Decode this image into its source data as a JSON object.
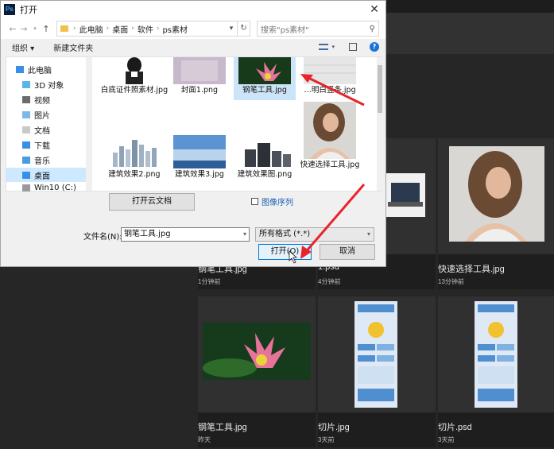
{
  "dialog": {
    "title": "打开",
    "app_logo": "Ps",
    "close_glyph": "✕",
    "breadcrumb": [
      "此电脑",
      "桌面",
      "软件",
      "ps素材"
    ],
    "search_placeholder": "搜索\"ps素材\"",
    "toolbar": {
      "organize": "组织 ▾",
      "new_folder": "新建文件夹"
    },
    "sidebar": [
      {
        "label": "此电脑",
        "icon": "computer-icon"
      },
      {
        "label": "3D 对象",
        "icon": "3d-objects-icon"
      },
      {
        "label": "视频",
        "icon": "video-icon"
      },
      {
        "label": "图片",
        "icon": "pictures-icon"
      },
      {
        "label": "文档",
        "icon": "documents-icon"
      },
      {
        "label": "下载",
        "icon": "downloads-icon"
      },
      {
        "label": "音乐",
        "icon": "music-icon"
      },
      {
        "label": "桌面",
        "icon": "desktop-icon",
        "selected": true
      },
      {
        "label": "Win10 (C:)",
        "icon": "drive-icon"
      }
    ],
    "files": [
      {
        "name": "白底证件照素材.jpg"
      },
      {
        "name": "封面1.png"
      },
      {
        "name": "钢笔工具.jpg",
        "selected": true
      },
      {
        "name": "…明白竖条.jpg"
      },
      {
        "name": "建筑效果2.png"
      },
      {
        "name": "建筑效果3.jpg"
      },
      {
        "name": "建筑效果图.png"
      },
      {
        "name": "快速选择工具.jpg"
      }
    ],
    "cloud_button": "打开云文档",
    "image_sequence": "图像序列",
    "filename_label": "文件名(N):",
    "filename_value": "钢笔工具.jpg",
    "filetype_value": "所有格式 (*.*)",
    "open_button": "打开(O)",
    "cancel_button": "取消"
  },
  "recent": [
    {
      "name": "钢笔工具.jpg",
      "time": "1分钟前"
    },
    {
      "name": "1.psd",
      "time": "4分钟前"
    },
    {
      "name": "快速选择工具.jpg",
      "time": "13分钟前"
    },
    {
      "name": "钢笔工具.jpg",
      "time": "昨天"
    },
    {
      "name": "切片.jpg",
      "time": "3天前"
    },
    {
      "name": "切片.psd",
      "time": "3天前"
    }
  ],
  "colors": {
    "ps_bg": "#262626",
    "accent": "#0078d7",
    "annotation": "#e8242a"
  }
}
